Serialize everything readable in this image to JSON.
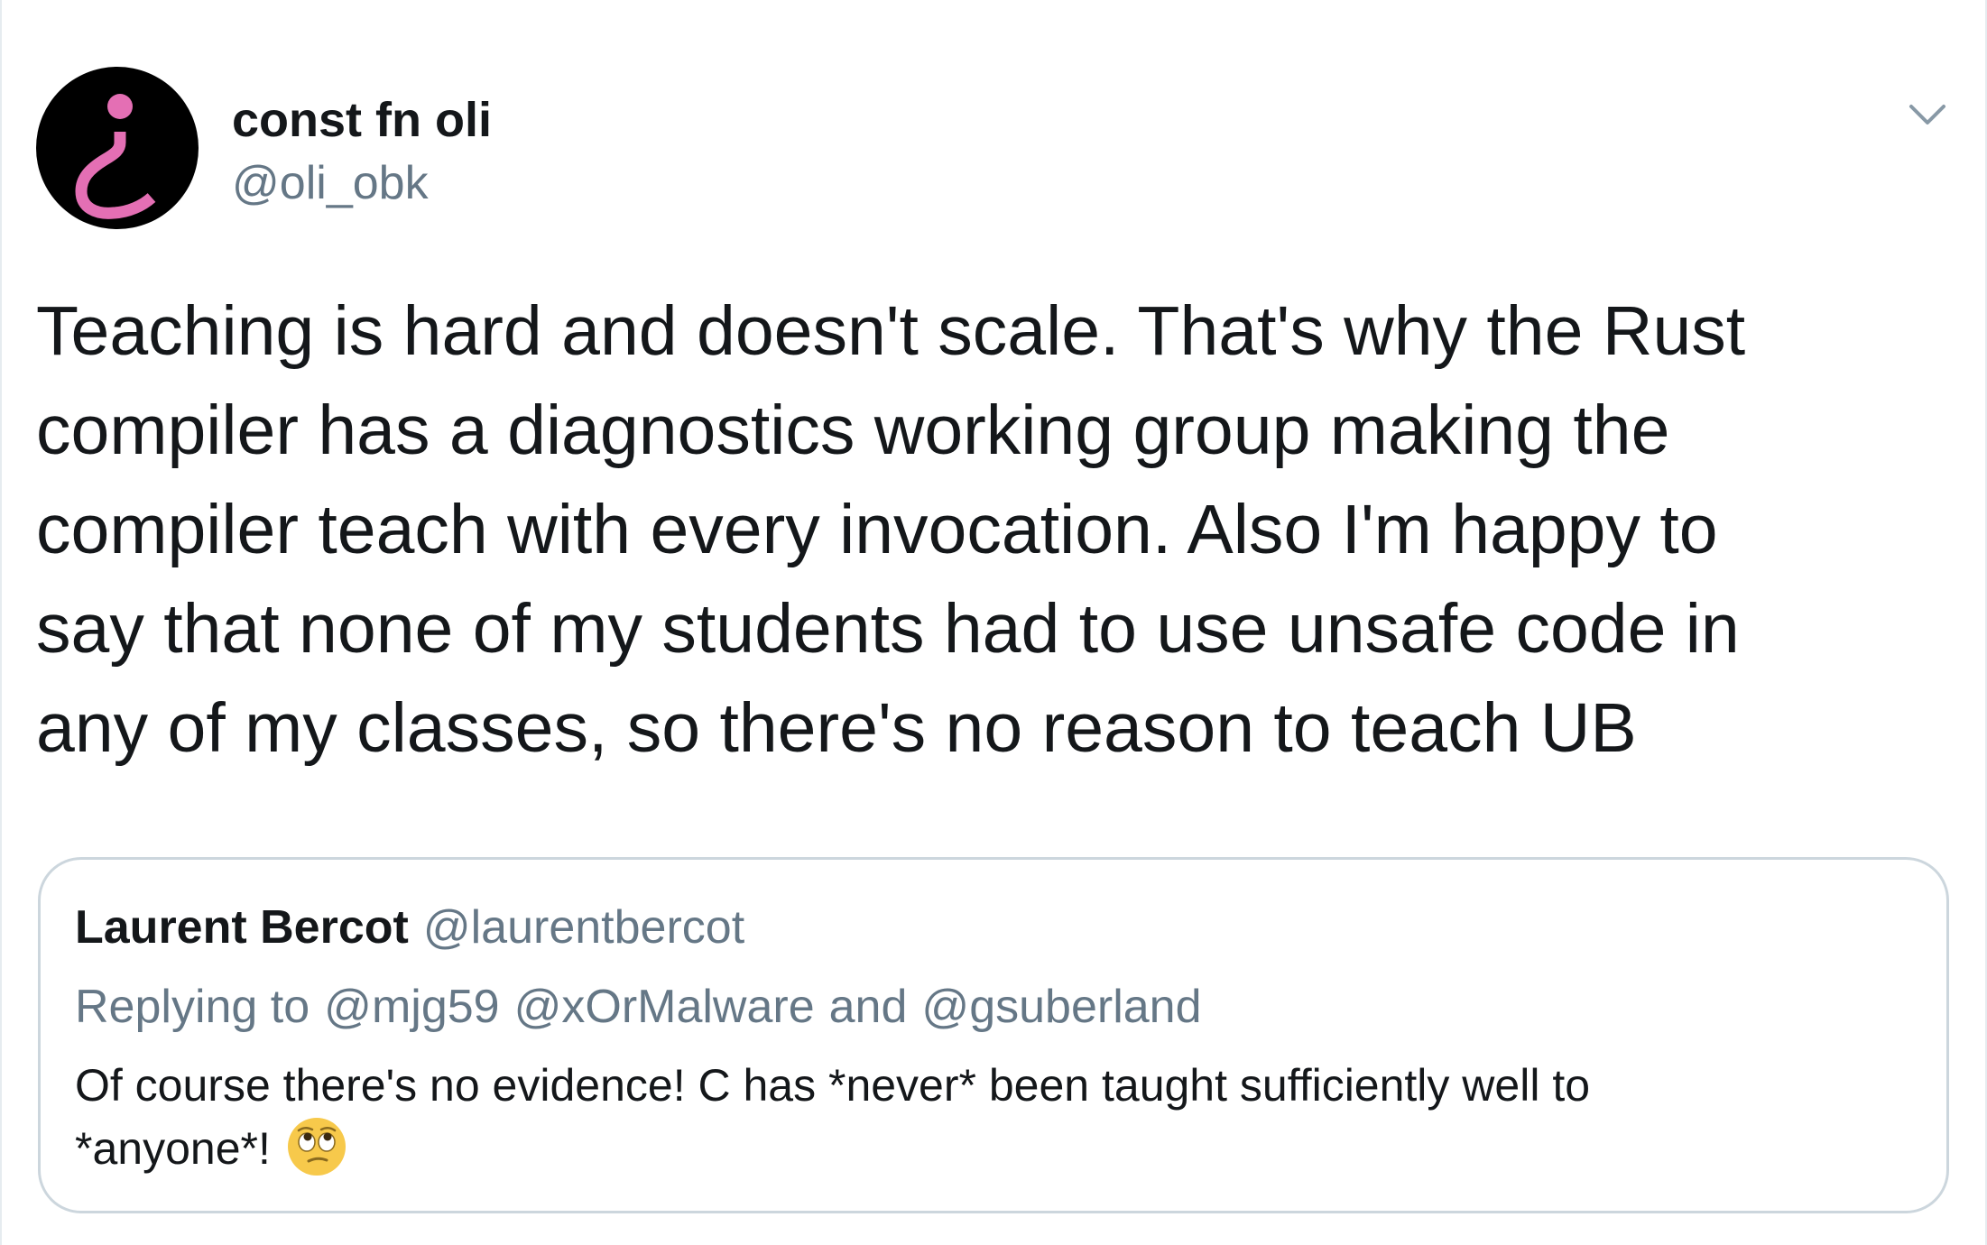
{
  "tweet": {
    "display_name": "const fn oli",
    "handle": "@oli_obk",
    "avatar_icon": "inverted-question-mark-avatar",
    "menu_icon": "chevron-down-icon",
    "text_lines": [
      "Teaching is hard and doesn't scale. That's why the Rust",
      "compiler has a diagnostics working group making the",
      "compiler teach with every invocation. Also I'm happy to",
      "say that none of my students had to use unsafe code in",
      "any of my classes, so there's no reason to teach UB"
    ]
  },
  "quoted_tweet": {
    "display_name": "Laurent Bercot",
    "handle": "@laurentbercot",
    "replying_prefix": "Replying to",
    "reply_mention_1": "@mjg59",
    "reply_mention_2": "@xOrMalware",
    "reply_and": "and",
    "reply_mention_3": "@gsuberland",
    "text_line_1": "Of course there's no evidence! C has *never* been taught sufficiently well to",
    "text_line_2": "*anyone*!",
    "emoji_icon": "face-with-rolling-eyes-emoji"
  },
  "colors": {
    "text_primary": "#14171a",
    "text_secondary": "#657786",
    "quote_border": "#ccd6dd",
    "avatar_bg": "#000000",
    "avatar_glyph": "#e46fb4"
  }
}
